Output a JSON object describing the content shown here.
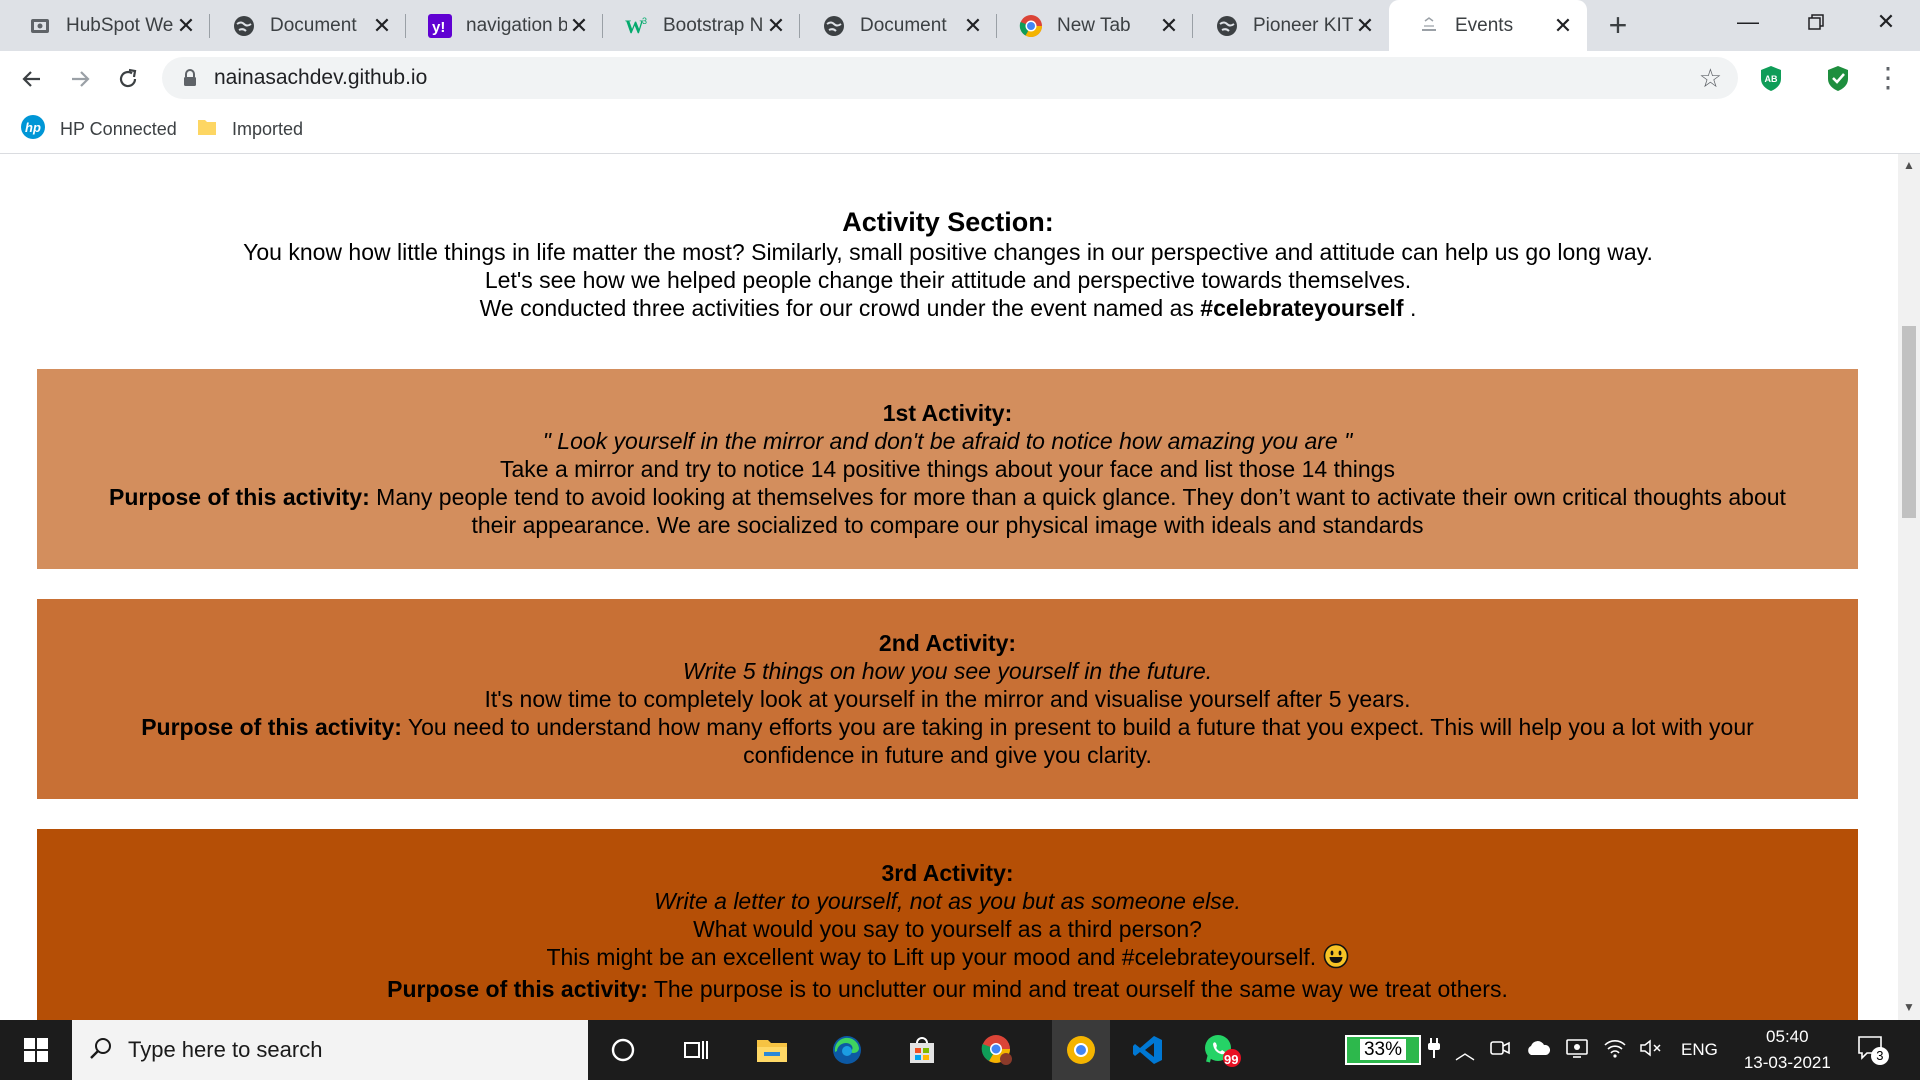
{
  "browser": {
    "tabs": [
      {
        "title": "HubSpot We",
        "icon": "hubspot-icon"
      },
      {
        "title": "Document",
        "icon": "globe-icon"
      },
      {
        "title": "navigation b",
        "icon": "yahoo-icon"
      },
      {
        "title": "Bootstrap N",
        "icon": "w3schools-icon"
      },
      {
        "title": "Document",
        "icon": "globe-icon"
      },
      {
        "title": "New Tab",
        "icon": "chrome-icon"
      },
      {
        "title": "Pioneer KITC",
        "icon": "globe-icon"
      },
      {
        "title": "Events",
        "icon": "page-icon"
      }
    ],
    "active_tab": 7,
    "url": "nainasachdev.github.io",
    "bookmarks": [
      {
        "label": "HP Connected",
        "icon": "hp-icon"
      },
      {
        "label": "Imported",
        "icon": "folder-icon"
      }
    ]
  },
  "page": {
    "intro": {
      "heading": "Activity Section:",
      "line1": "You know how little things in life matter the most? Similarly, small positive changes in our perspective and attitude can help us go long way.",
      "line2": "Let's see how we helped people change their attitude and perspective towards themselves.",
      "line3_prefix": "We conducted three activities for our crowd under the event named as",
      "line3_tag": "#celebrateyourself",
      "line3_suffix": "."
    },
    "activities": [
      {
        "title": "1st Activity:",
        "quote": "\" Look yourself in the mirror and don't be afraid to notice how amazing you are \"",
        "task": "Take a mirror and try to notice 14 positive things about your face and list those 14 things",
        "purpose_label": "Purpose of this activity:",
        "purpose": "Many people tend to avoid looking at themselves for more than a quick glance. They don’t want to activate their own critical thoughts about their appearance. We are socialized to compare our physical image with ideals and standards",
        "color": "#d38e5d"
      },
      {
        "title": "2nd Activity:",
        "quote": "Write 5 things on how you see yourself in the future.",
        "task": "It's now time to completely look at yourself in the mirror and visualise yourself after 5 years.",
        "purpose_label": "Purpose of this activity:",
        "purpose": "You need to understand how many efforts you are taking in present to build a future that you expect. This will help you a lot with your confidence in future and give you clarity.",
        "color": "#c87035"
      },
      {
        "title": "3rd Activity:",
        "quote": "Write a letter to yourself, not as you but as someone else.",
        "task": "What would you say to yourself as a third person?",
        "task2": "This might be an excellent way to Lift up your mood and #celebrateyourself.",
        "purpose_label": "Purpose of this activity:",
        "purpose": "The purpose is to unclutter our mind and treat ourself the same way we treat others.",
        "color": "#b54f06"
      }
    ]
  },
  "taskbar": {
    "search_placeholder": "Type here to search",
    "battery": "33%",
    "language": "ENG",
    "time": "05:40",
    "date": "13-03-2021",
    "whatsapp_badge": "99",
    "notifications": "3"
  }
}
